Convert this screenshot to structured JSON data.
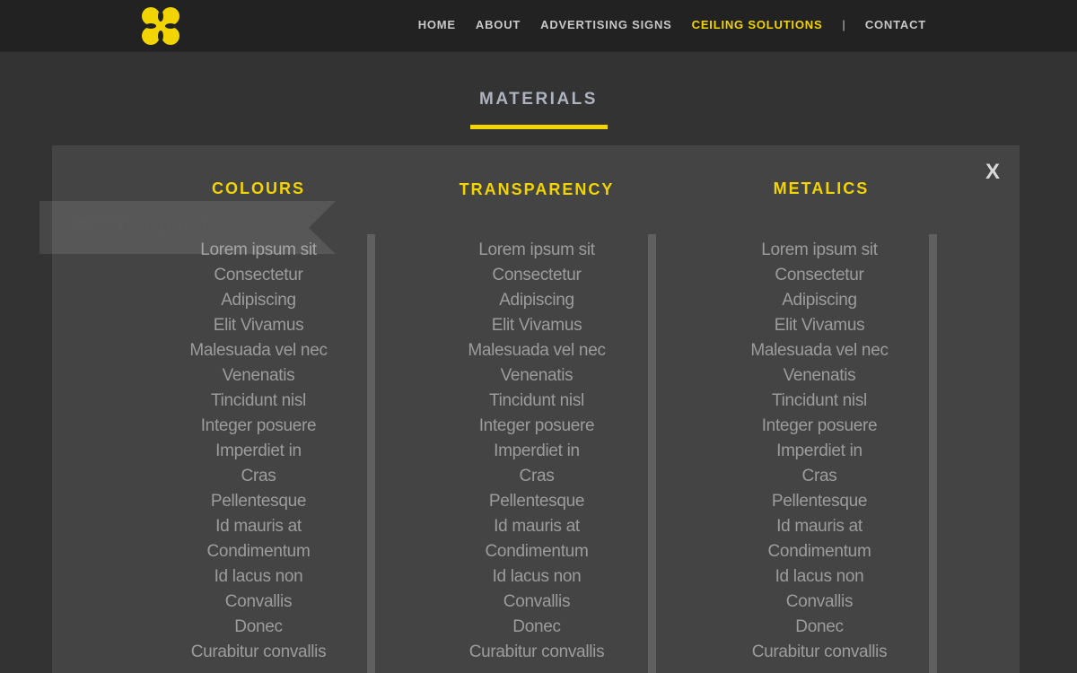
{
  "colors": {
    "accent": "#f2d400",
    "header_bg": "#222222",
    "page_bg": "#333333",
    "panel_bg": "#444444"
  },
  "logo": {
    "icon": "four-lobed-logo-icon"
  },
  "nav": {
    "items": [
      {
        "label": "HOME"
      },
      {
        "label": "ABOUT"
      },
      {
        "label": "ADVERTISING SIGNS"
      },
      {
        "label": "CEILING SOLUTIONS",
        "active": true
      }
    ],
    "separator": "|",
    "contact": "CONTACT"
  },
  "section": {
    "title": "MATERIALS"
  },
  "panel": {
    "close_label": "X"
  },
  "annotation": {
    "text": "#ffffff; opacity: 0.1"
  },
  "columns": [
    {
      "heading": "COLOURS",
      "items": [
        "Lorem ipsum sit",
        "Consectetur",
        "Adipiscing",
        "Elit Vivamus",
        "Malesuada vel nec",
        "Venenatis",
        "Tincidunt nisl",
        "Integer posuere",
        "Imperdiet in",
        "Cras",
        "Pellentesque",
        "Id mauris at",
        "Condimentum",
        "Id lacus non",
        "Convallis",
        "Donec",
        "Curabitur convallis"
      ]
    },
    {
      "heading": "TRANSPARENCY",
      "items": [
        "Lorem ipsum sit",
        "Consectetur",
        "Adipiscing",
        "Elit Vivamus",
        "Malesuada vel nec",
        "Venenatis",
        "Tincidunt nisl",
        "Integer posuere",
        "Imperdiet in",
        "Cras",
        "Pellentesque",
        "Id mauris at",
        "Condimentum",
        "Id lacus non",
        "Convallis",
        "Donec",
        "Curabitur convallis"
      ]
    },
    {
      "heading": "METALICS",
      "items": [
        "Lorem ipsum sit",
        "Consectetur",
        "Adipiscing",
        "Elit Vivamus",
        "Malesuada vel nec",
        "Venenatis",
        "Tincidunt nisl",
        "Integer posuere",
        "Imperdiet in",
        "Cras",
        "Pellentesque",
        "Id mauris at",
        "Condimentum",
        "Id lacus non",
        "Convallis",
        "Donec",
        "Curabitur convallis"
      ]
    }
  ]
}
